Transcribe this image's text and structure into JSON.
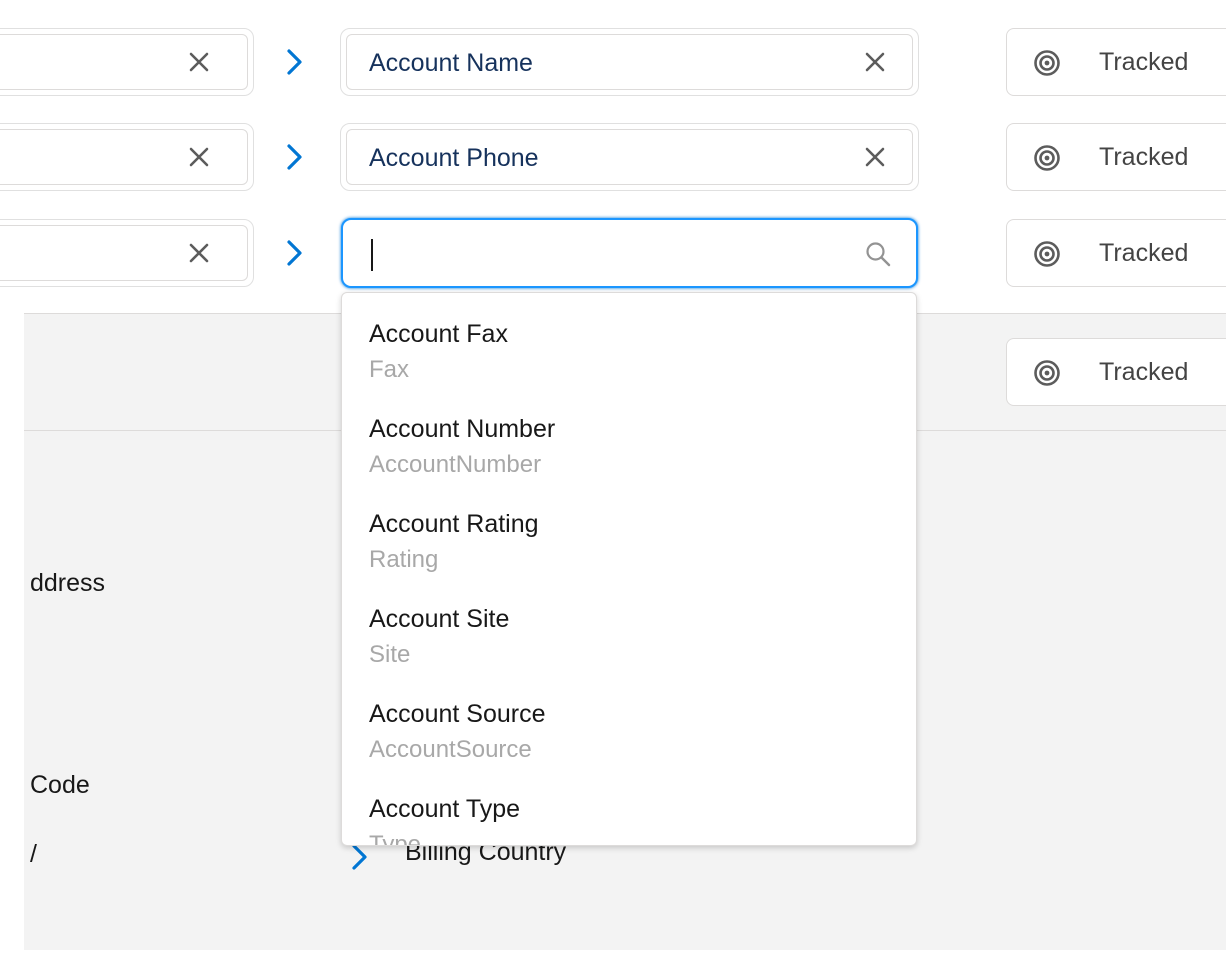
{
  "mapping_rows": [
    {
      "target_value": "Account Name",
      "status": "Tracked"
    },
    {
      "target_value": "Account Phone",
      "status": "Tracked"
    },
    {
      "target_value": "",
      "status": "Tracked"
    }
  ],
  "extra_status": "Tracked",
  "search": {
    "value": "",
    "placeholder": ""
  },
  "background_labels": [
    "ddress",
    "Code",
    "/"
  ],
  "background_target": "Billing Country",
  "dropdown_options": [
    {
      "label": "Account Fax",
      "api_name": "Fax"
    },
    {
      "label": "Account Number",
      "api_name": "AccountNumber"
    },
    {
      "label": "Account Rating",
      "api_name": "Rating"
    },
    {
      "label": "Account Site",
      "api_name": "Site"
    },
    {
      "label": "Account Source",
      "api_name": "AccountSource"
    },
    {
      "label": "Account Type",
      "api_name": "Type"
    }
  ],
  "colors": {
    "chevron": "#0176d3",
    "target_text": "#16325c",
    "focus_border": "#1b96ff",
    "api_name": "#a8a8a8",
    "panel_bg": "#f3f3f3"
  }
}
